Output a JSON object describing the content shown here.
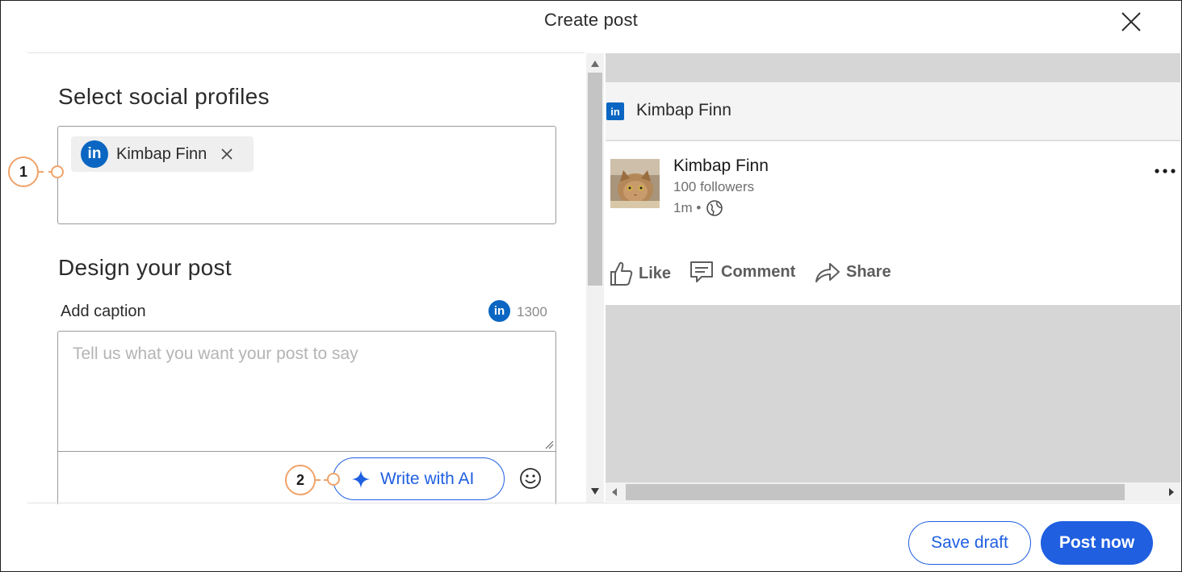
{
  "header": {
    "title": "Create post"
  },
  "profiles": {
    "heading": "Select social profiles",
    "selected": [
      {
        "network": "linkedin",
        "name": "Kimbap Finn"
      }
    ]
  },
  "design": {
    "heading": "Design your post",
    "caption_label": "Add caption",
    "char_limit": "1300",
    "caption_value": "",
    "caption_placeholder": "Tell us what you want your post to say",
    "ai_button": "Write with AI"
  },
  "callouts": {
    "one": "1",
    "two": "2"
  },
  "preview": {
    "network_name": "Kimbap Finn",
    "author_name": "Kimbap Finn",
    "followers": "100 followers",
    "time": "1m •",
    "actions": {
      "like": "Like",
      "comment": "Comment",
      "share": "Share"
    }
  },
  "footer": {
    "save_draft": "Save draft",
    "post_now": "Post now"
  },
  "colors": {
    "accent": "#1f5fe0",
    "linkedin": "#0a66c2",
    "callout": "#f0a36a",
    "preview_bg": "#d6d6d6"
  }
}
